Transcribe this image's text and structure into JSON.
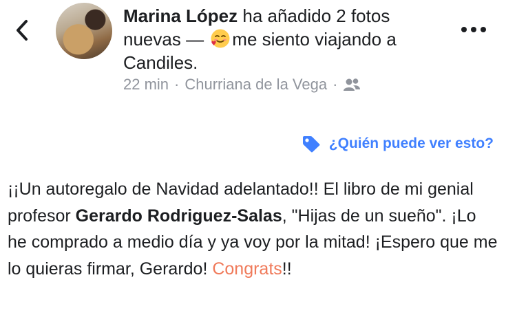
{
  "header": {
    "back_icon": "chevron-left-icon",
    "author": "Marina López",
    "action": " ha añadido 2 fotos nuevas — ",
    "emoji_icon": "smiling-heart-emoji",
    "feeling": "me siento viajando a Candiles.",
    "time": "22 min",
    "separator": "·",
    "location": "Churriana de la Vega",
    "audience_icon": "friends-icon",
    "more_icon": "more-horizontal-icon"
  },
  "privacy": {
    "icon": "tag-icon",
    "label": "¿Quién puede ver esto?"
  },
  "post": {
    "part1": "¡¡Un autoregalo de Navidad adelantado!! El libro de mi genial profesor ",
    "bold_name": "Gerardo Rodriguez-Salas",
    "part2": ", \"Hijas de un sueño\". ¡Lo he comprado a medio día y ya voy por la mitad! ¡Espero que me lo quieras firmar, Gerardo! ",
    "highlight": "Congrats",
    "part3": "!!"
  },
  "colors": {
    "link": "#4080ff",
    "meta": "#90949c",
    "congrats": "#f07a5a",
    "text": "#1c1e21"
  }
}
